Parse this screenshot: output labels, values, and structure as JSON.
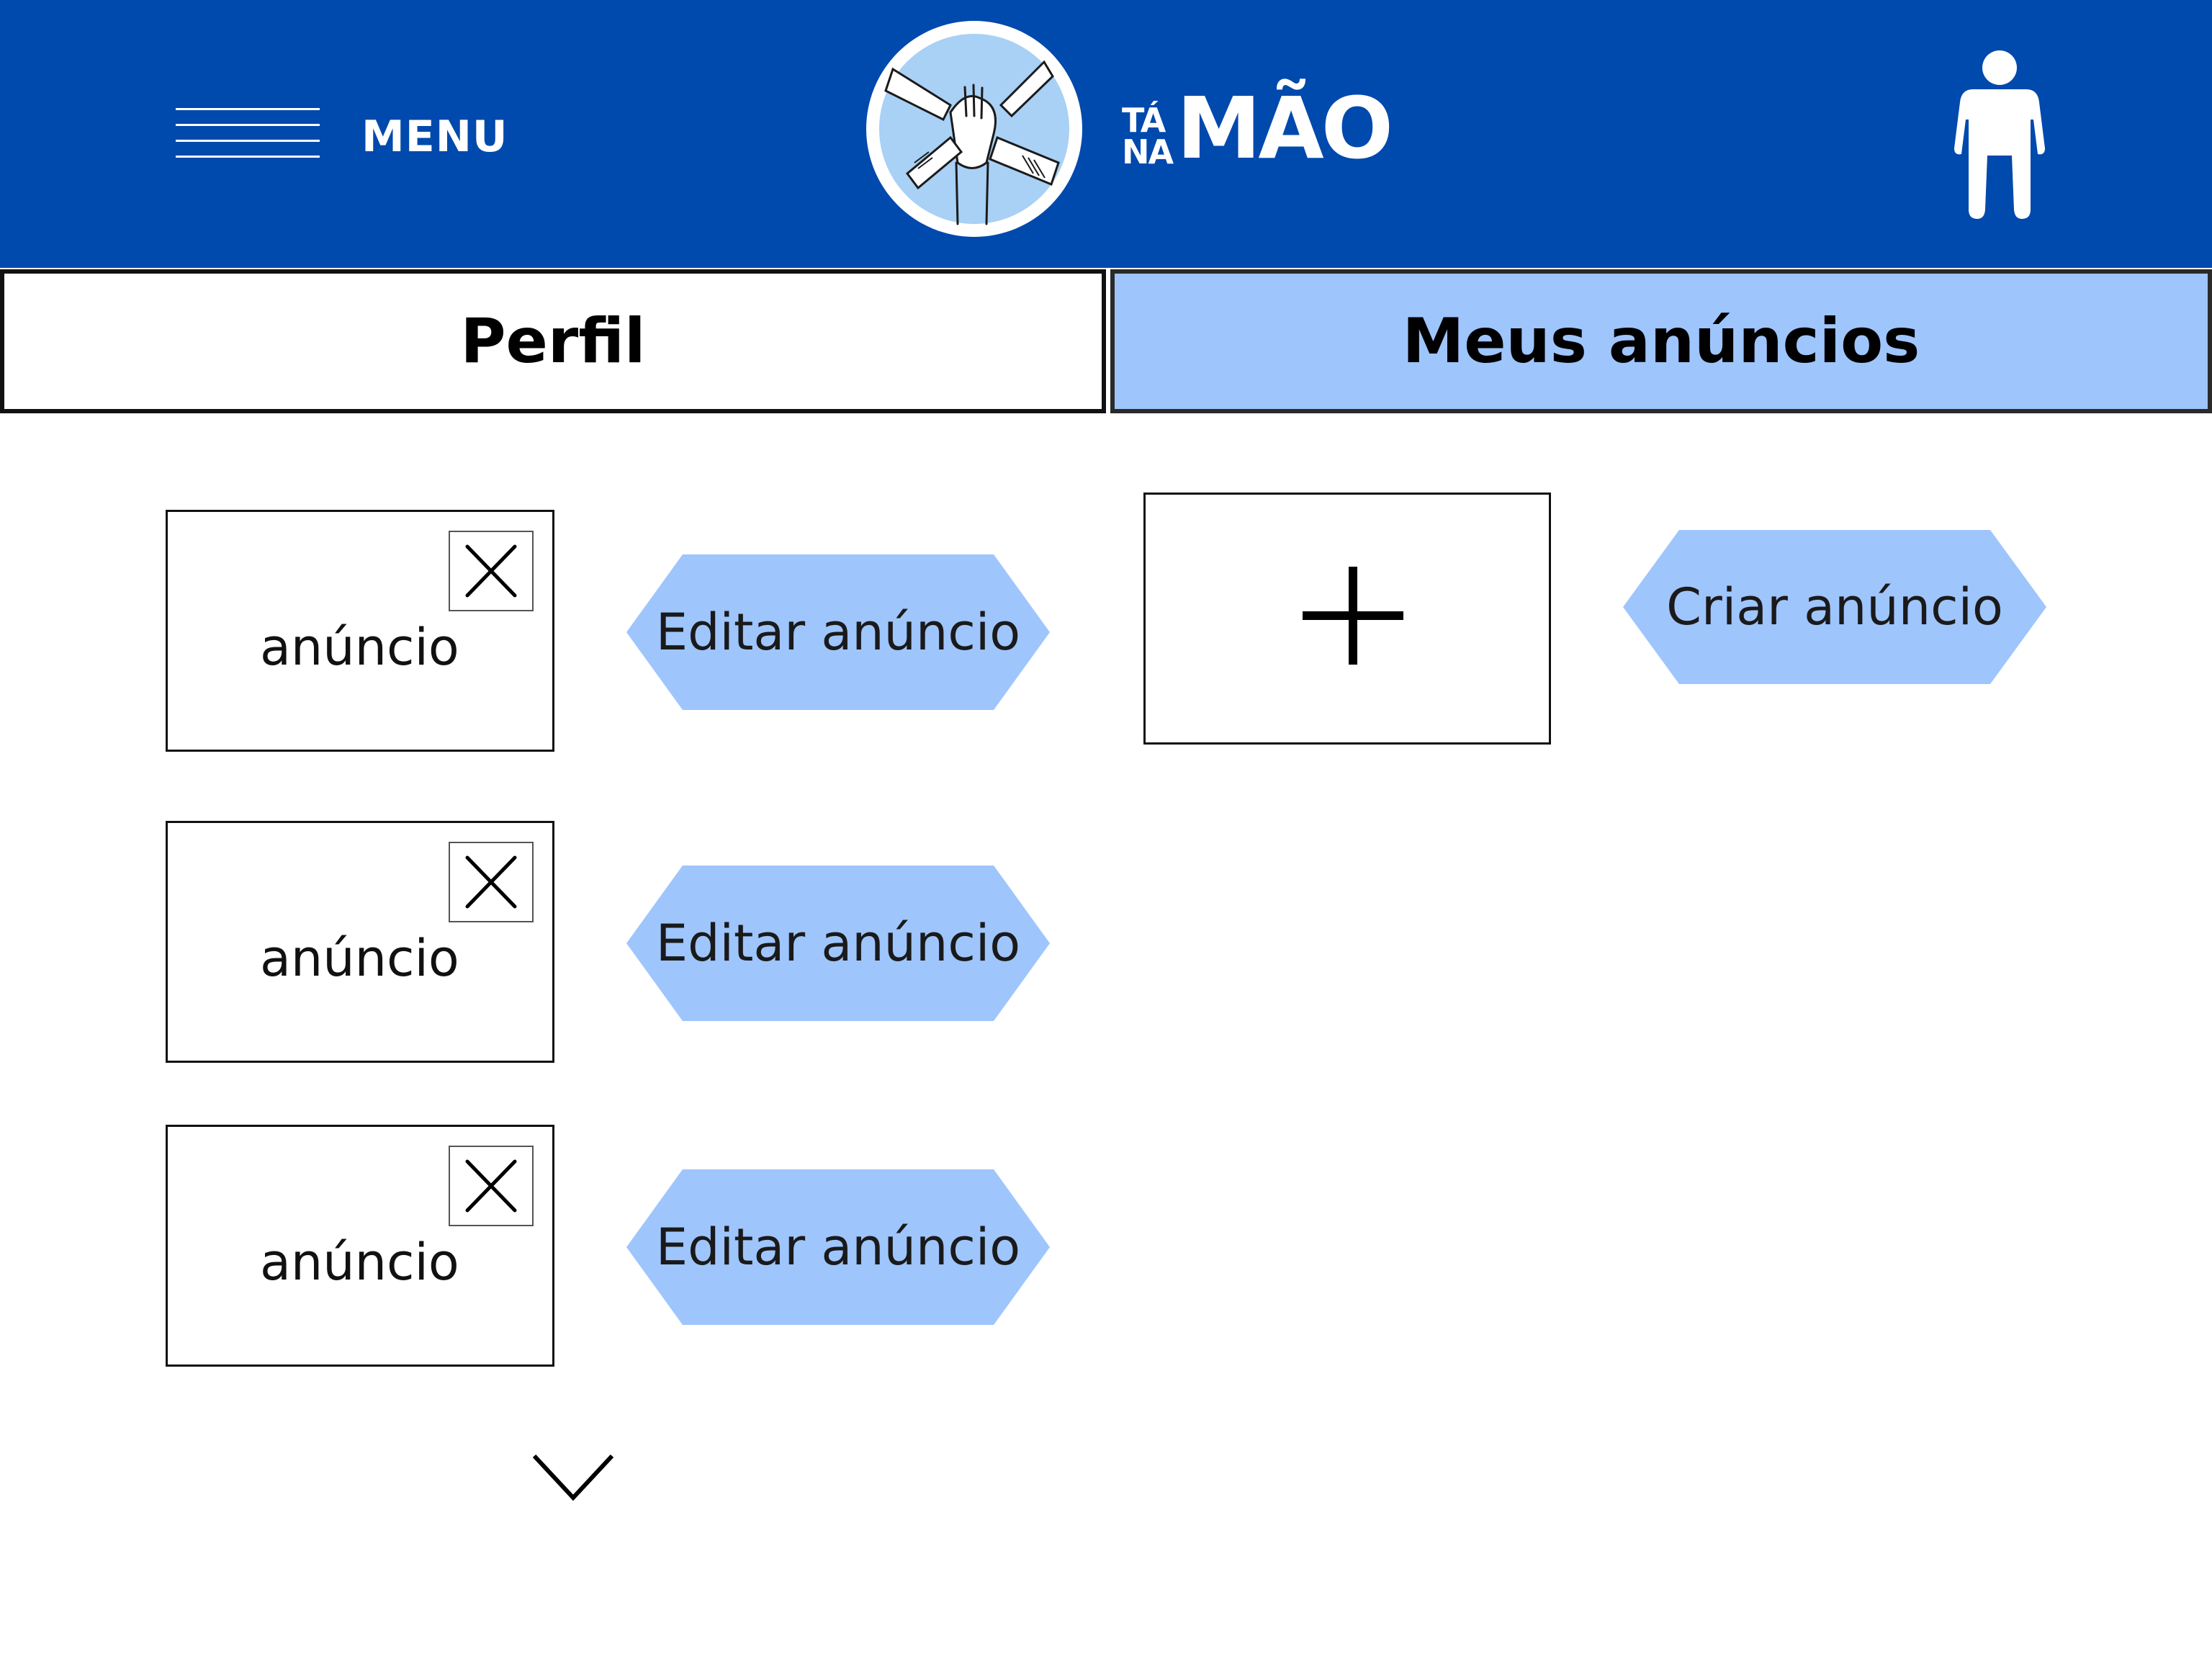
{
  "header": {
    "menu_label": "MENU",
    "logo": {
      "line1": "TÁ",
      "line2": "NA",
      "big": "MÃO"
    },
    "colors": {
      "header_bg": "#0049ad",
      "accent": "#9fc5fd"
    },
    "profile_icon": "person-icon"
  },
  "tabs": [
    {
      "label": "Perfil",
      "active": false
    },
    {
      "label": "Meus anúncios",
      "active": true
    }
  ],
  "ads": [
    {
      "label": "anúncio",
      "edit_label": "Editar anúncio"
    },
    {
      "label": "anúncio",
      "edit_label": "Editar anúncio"
    },
    {
      "label": "anúncio",
      "edit_label": "Editar anúncio"
    }
  ],
  "create": {
    "label": "Criar anúncio",
    "icon": "plus-icon"
  },
  "scroll": {
    "icon": "chevron-down-icon"
  }
}
